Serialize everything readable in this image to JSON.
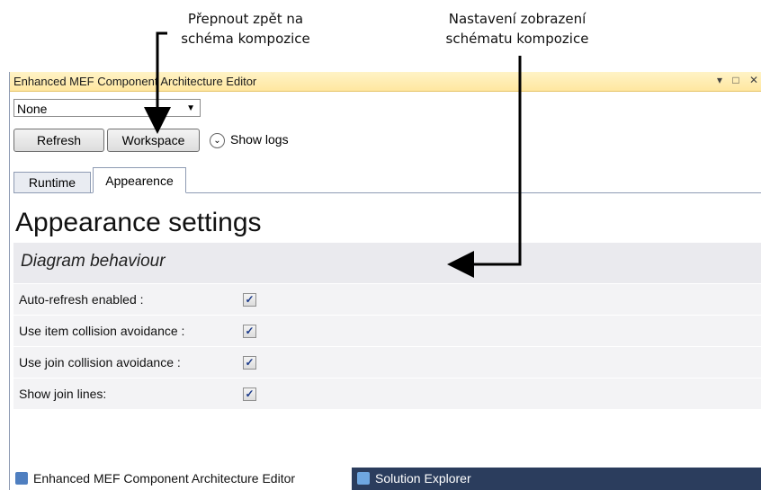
{
  "annotations": {
    "left_line1": "Přepnout zpět na",
    "left_line2": "schéma kompozice",
    "right_line1": "Nastavení zobrazení",
    "right_line2": "schématu kompozice"
  },
  "window": {
    "title": "Enhanced MEF Component Architecture Editor",
    "controls": "▾ □ ✕"
  },
  "toolbar": {
    "dropdown_value": "None",
    "refresh_label": "Refresh",
    "workspace_label": "Workspace",
    "show_logs_label": "Show logs"
  },
  "tabs": [
    {
      "label": "Runtime"
    },
    {
      "label": "Appearence"
    }
  ],
  "main": {
    "heading": "Appearance settings",
    "section_title": "Diagram behaviour",
    "rows": [
      {
        "label": "Auto-refresh enabled :",
        "checked": true
      },
      {
        "label": "Use item collision avoidance :",
        "checked": true
      },
      {
        "label": "Use join collision avoidance :",
        "checked": true
      },
      {
        "label": "Show join lines:",
        "checked": true
      }
    ]
  },
  "bottom_tabs": [
    {
      "label": "Enhanced MEF Component Architecture Editor",
      "icon": "mef-editor-icon"
    },
    {
      "label": "Solution Explorer",
      "icon": "solution-explorer-icon"
    }
  ]
}
